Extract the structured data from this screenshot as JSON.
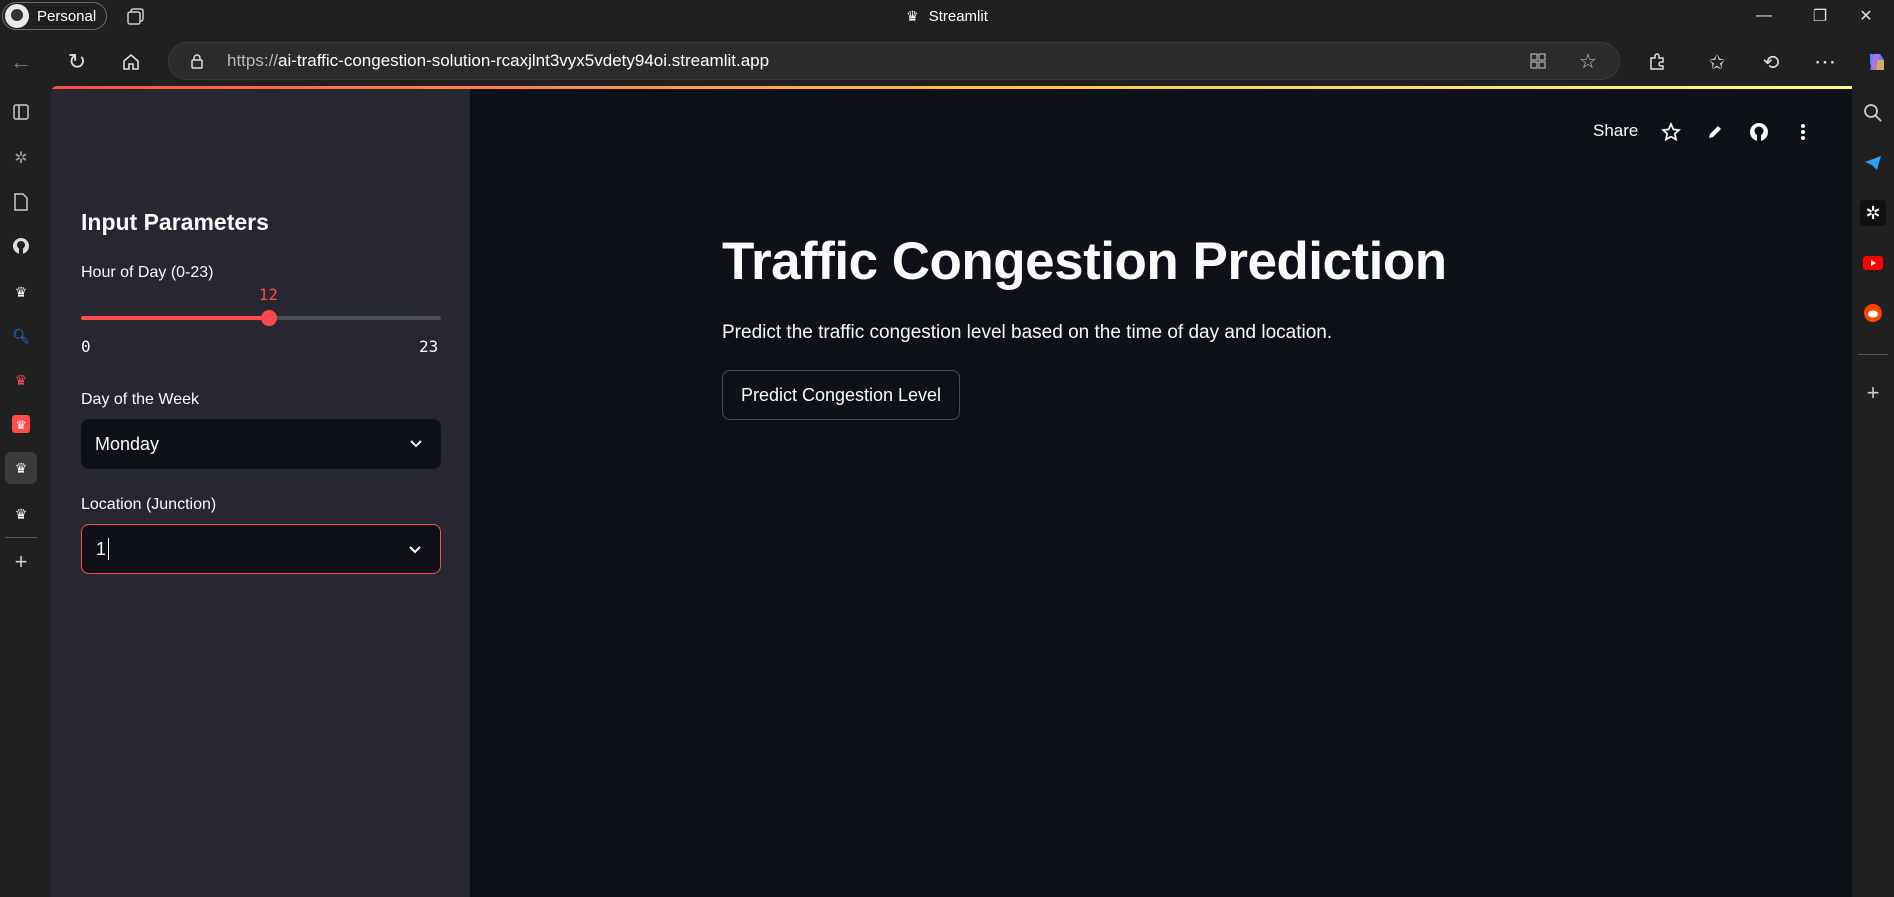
{
  "browser": {
    "profile_label": "Personal",
    "window_title": "Streamlit",
    "url_proto": "https://",
    "url_host": "ai-traffic-congestion-solution-rcaxjlnt3vyx5vdety94oi.streamlit.app"
  },
  "sidebar": {
    "title": "Input Parameters",
    "hour_label": "Hour of Day (0-23)",
    "hour_value": "12",
    "hour_min": "0",
    "hour_max": "23",
    "hour_fraction": 0.5217,
    "day_label": "Day of the Week",
    "day_value": "Monday",
    "location_label": "Location (Junction)",
    "location_value": "1"
  },
  "toolbar": {
    "share_label": "Share"
  },
  "main": {
    "title": "Traffic Congestion Prediction",
    "subtitle": "Predict the traffic congestion level based on the time of day and location.",
    "predict_button": "Predict Congestion Level"
  },
  "colors": {
    "accent": "#ff4b4b",
    "app_bg": "#0e1117",
    "sidebar_bg": "#262730"
  }
}
